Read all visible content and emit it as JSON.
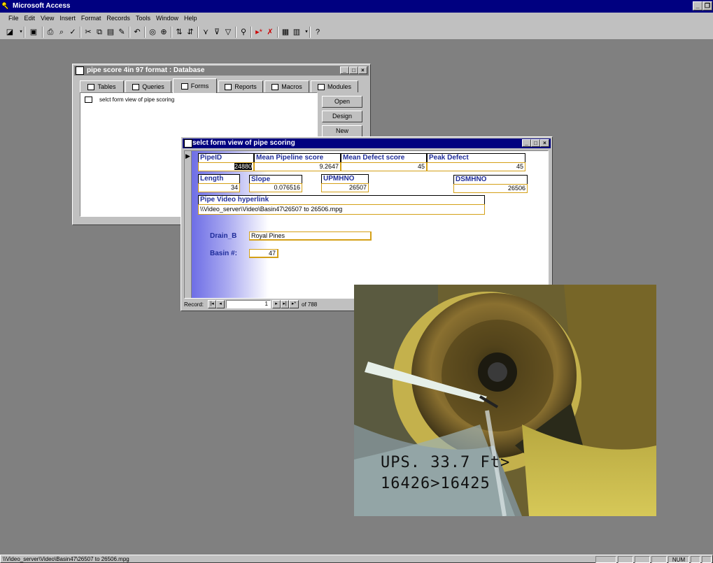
{
  "app": {
    "title": "Microsoft Access",
    "menu": [
      "File",
      "Edit",
      "View",
      "Insert",
      "Format",
      "Records",
      "Tools",
      "Window",
      "Help"
    ],
    "status_text": "\\\\Video_server\\Video\\Basin47\\26507 to 26506.mpg",
    "status_num": "NUM"
  },
  "db_window": {
    "title": "pipe score 4in 97 format : Database",
    "tabs": [
      "Tables",
      "Queries",
      "Forms",
      "Reports",
      "Macros",
      "Modules"
    ],
    "active_tab": "Forms",
    "items": [
      "selct form view of pipe scoring"
    ],
    "buttons": {
      "open": "Open",
      "design": "Design",
      "new": "New"
    }
  },
  "form_window": {
    "title": "selct form view of pipe scoring",
    "labels": {
      "pipe_id": "PipeID",
      "mean_pipeline": "Mean Pipeline score",
      "mean_defect": "Mean Defect score",
      "peak_defect": "Peak Defect",
      "length": "Length",
      "slope": "Slope",
      "upmhno": "UPMHNO",
      "dsmhno": "DSMHNO",
      "pipe_video": "Pipe Video hyperlink",
      "drain_b": "Drain_B",
      "basin": "Basin #:"
    },
    "values": {
      "pipe_id": "24880",
      "mean_pipeline": "9.2647",
      "mean_defect": "45",
      "peak_defect": "45",
      "length": "34",
      "slope": "0.076516",
      "upmhno": "26507",
      "dsmhno": "26506",
      "pipe_video": "\\\\Video_server\\Video\\Basin47\\26507 to 26506.mpg",
      "drain_b": "Royal Pines",
      "basin": "47"
    },
    "record_nav": {
      "label": "Record:",
      "current": "1",
      "of_text": "of 788"
    }
  },
  "video_overlay": {
    "line1": "UPS.   33.7 Ft>",
    "line2": "16426>16425"
  },
  "colors": {
    "titlebar": "#000080",
    "workspace": "#808080",
    "field_border": "#d4a017",
    "label_blue": "#1f2d9a"
  }
}
